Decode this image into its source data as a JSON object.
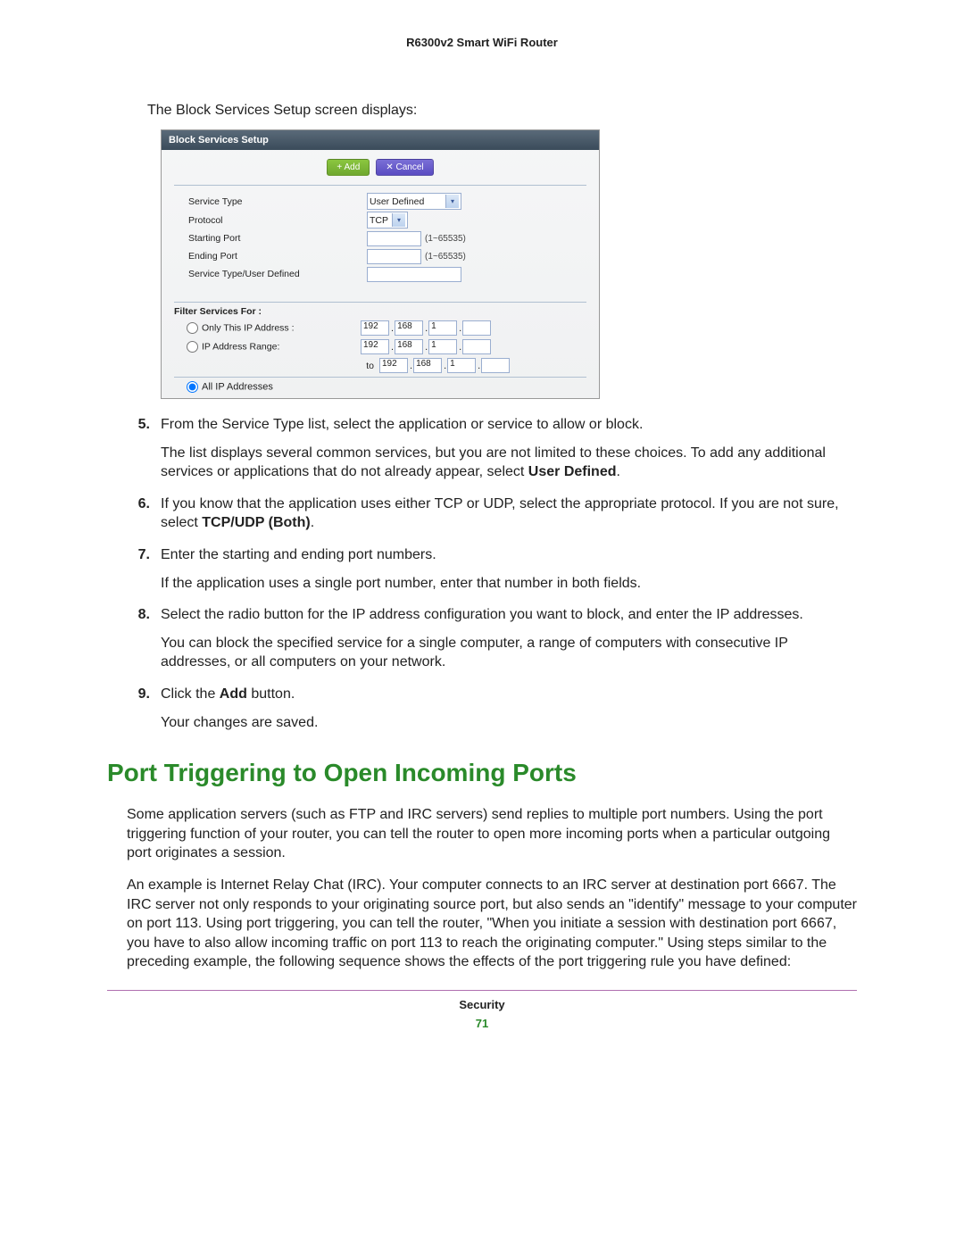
{
  "header": {
    "title": "R6300v2 Smart WiFi Router"
  },
  "intro": "The Block Services Setup screen displays:",
  "screenshot": {
    "titlebar": "Block Services Setup",
    "buttons": {
      "add": "+ Add",
      "cancel": "✕ Cancel"
    },
    "fields": {
      "service_type_label": "Service Type",
      "service_type_value": "User Defined",
      "protocol_label": "Protocol",
      "protocol_value": "TCP",
      "starting_port_label": "Starting Port",
      "ending_port_label": "Ending Port",
      "port_hint": "(1~65535)",
      "user_defined_label": "Service Type/User Defined"
    },
    "filter_header": "Filter Services For :",
    "radio": {
      "only_ip": "Only This IP Address :",
      "range": "IP Address Range:",
      "to": "to",
      "all": "All IP Addresses"
    },
    "ip1": [
      "192",
      "168",
      "1",
      ""
    ],
    "ip2a": [
      "192",
      "168",
      "1",
      ""
    ],
    "ip2b": [
      "192",
      "168",
      "1",
      ""
    ]
  },
  "steps": {
    "s5": {
      "num": "5.",
      "p1": "From the Service Type list, select the application or service to allow or block.",
      "p2a": "The list displays several common services, but you are not limited to these choices. To add any additional services or applications that do not already appear, select ",
      "p2b": "User Defined",
      "p2c": "."
    },
    "s6": {
      "num": "6.",
      "p1a": "If you know that the application uses either TCP or UDP, select the appropriate protocol. If you are not sure, select ",
      "p1b": "TCP/UDP (Both)",
      "p1c": "."
    },
    "s7": {
      "num": "7.",
      "p1": "Enter the starting and ending port numbers.",
      "p2": "If the application uses a single port number, enter that number in both fields."
    },
    "s8": {
      "num": "8.",
      "p1": "Select the radio button for the IP address configuration you want to block, and enter the IP addresses.",
      "p2": "You can block the specified service for a single computer, a range of computers with consecutive IP addresses, or all computers on your network."
    },
    "s9": {
      "num": "9.",
      "p1a": "Click the ",
      "p1b": "Add",
      "p1c": " button.",
      "p2": "Your changes are saved."
    }
  },
  "section_title": "Port Triggering to Open Incoming Ports",
  "para1": "Some application servers (such as FTP and IRC servers) send replies to multiple port numbers. Using the port triggering function of your router, you can tell the router to open more incoming ports when a particular outgoing port originates a session.",
  "para2": "An example is Internet Relay Chat (IRC). Your computer connects to an IRC server at destination port 6667. The IRC server not only responds to your originating source port, but also sends an \"identify\" message to your computer on port 113. Using port triggering, you can tell the router, \"When you initiate a session with destination port 6667, you have to also allow incoming traffic on port 113 to reach the originating computer.\" Using steps similar to the preceding example, the following sequence shows the effects of the port triggering rule you have defined:",
  "footer": {
    "section": "Security",
    "page": "71"
  }
}
